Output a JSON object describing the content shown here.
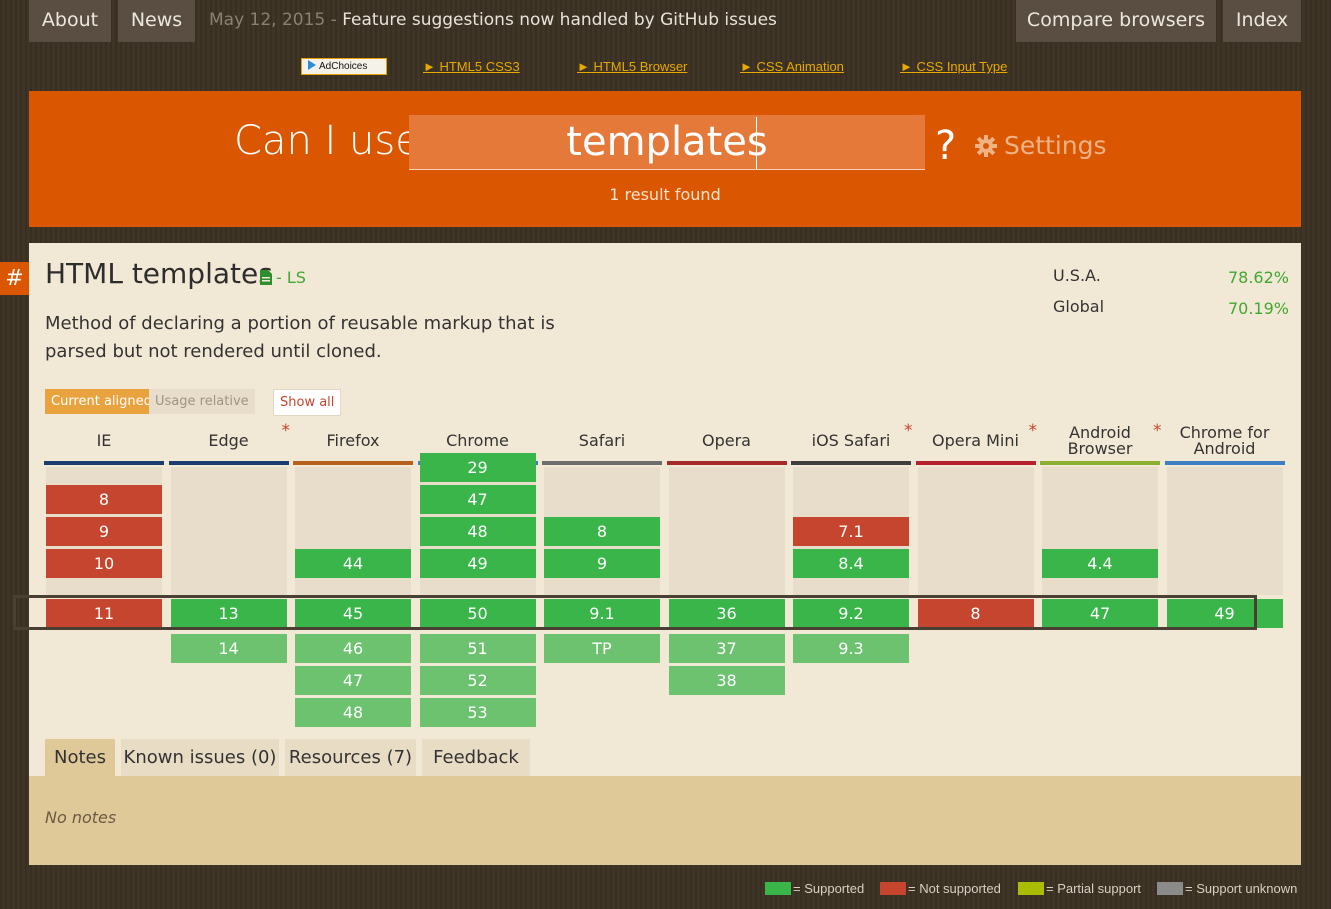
{
  "nav": {
    "about": "About",
    "news": "News",
    "news_date": "May 12, 2015 - ",
    "news_text": "Feature suggestions now handled by GitHub issues",
    "compare": "Compare browsers",
    "index": "Index"
  },
  "ads": {
    "adchoices": "AdChoices",
    "links": [
      "► HTML5 CSS3",
      "► HTML5 Browser",
      "► CSS Animation",
      "► CSS Input Type"
    ]
  },
  "search": {
    "prefix": "Can I use",
    "query": "templates",
    "question_mark": "?",
    "settings": "Settings",
    "result_count": "1 result found"
  },
  "feature": {
    "anchor": "#",
    "title": "HTML templates",
    "spec_status": "- LS",
    "description": "Method of declaring a portion of reusable markup that is parsed but not rendered until cloned.",
    "usage": [
      {
        "label": "U.S.A.",
        "value": "78.62%"
      },
      {
        "label": "Global",
        "value": "70.19%"
      }
    ],
    "toggles": {
      "current_aligned": "Current aligned",
      "usage_relative": "Usage relative",
      "show_all": "Show all"
    }
  },
  "colors": {
    "supported": "#39b54a",
    "supported_future": "#6cc26f",
    "not_supported": "#c6452f",
    "partial": "#a8bd04",
    "unknown": "#8b8b8b",
    "brand_orange": "#db5600"
  },
  "browsers": [
    {
      "name": "IE",
      "bar": "#1a3c6e",
      "star": false,
      "past": [
        {
          "v": "8",
          "s": "n"
        },
        {
          "v": "9",
          "s": "n"
        },
        {
          "v": "10",
          "s": "n"
        }
      ],
      "current": {
        "v": "11",
        "s": "n"
      },
      "future": []
    },
    {
      "name": "Edge",
      "bar": "#1a3c6e",
      "star": true,
      "past": [],
      "current": {
        "v": "13",
        "s": "y"
      },
      "future": [
        {
          "v": "14",
          "s": "y"
        }
      ]
    },
    {
      "name": "Firefox",
      "bar": "#b5601c",
      "star": false,
      "past": [
        {
          "v": "44",
          "s": "y"
        }
      ],
      "current": {
        "v": "45",
        "s": "y"
      },
      "future": [
        {
          "v": "46",
          "s": "y"
        },
        {
          "v": "47",
          "s": "y"
        },
        {
          "v": "48",
          "s": "y"
        }
      ]
    },
    {
      "name": "Chrome",
      "bar": "#3d7fc1",
      "star": false,
      "past": [
        {
          "v": "29",
          "s": "y"
        },
        {
          "v": "47",
          "s": "y"
        },
        {
          "v": "48",
          "s": "y"
        },
        {
          "v": "49",
          "s": "y"
        }
      ],
      "current": {
        "v": "50",
        "s": "y"
      },
      "future": [
        {
          "v": "51",
          "s": "y"
        },
        {
          "v": "52",
          "s": "y"
        },
        {
          "v": "53",
          "s": "y"
        }
      ]
    },
    {
      "name": "Safari",
      "bar": "#6d6d6d",
      "star": false,
      "past": [
        {
          "v": "8",
          "s": "y"
        },
        {
          "v": "9",
          "s": "y"
        }
      ],
      "current": {
        "v": "9.1",
        "s": "y"
      },
      "future": [
        {
          "v": "TP",
          "s": "y"
        }
      ]
    },
    {
      "name": "Opera",
      "bar": "#a52a2a",
      "star": false,
      "past": [],
      "current": {
        "v": "36",
        "s": "y"
      },
      "future": [
        {
          "v": "37",
          "s": "y"
        },
        {
          "v": "38",
          "s": "y"
        }
      ]
    },
    {
      "name": "iOS Safari",
      "bar": "#3f3f3f",
      "star": true,
      "past": [
        {
          "v": "7.1",
          "s": "n"
        },
        {
          "v": "8.4",
          "s": "y"
        }
      ],
      "current": {
        "v": "9.2",
        "s": "y"
      },
      "future": [
        {
          "v": "9.3",
          "s": "y"
        }
      ]
    },
    {
      "name": "Opera Mini",
      "bar": "#b5202c",
      "star": true,
      "past": [],
      "current": {
        "v": "8",
        "s": "n"
      },
      "future": []
    },
    {
      "name": "Android Browser",
      "bar": "#8bb02f",
      "star": true,
      "past": [
        {
          "v": "4.4",
          "s": "y"
        }
      ],
      "current": {
        "v": "47",
        "s": "y"
      },
      "future": []
    },
    {
      "name": "Chrome for Android",
      "bar": "#3d7fc1",
      "star": false,
      "past": [],
      "current": {
        "v": "49",
        "s": "y"
      },
      "future": []
    }
  ],
  "tabs": [
    "Notes",
    "Known issues (0)",
    "Resources (7)",
    "Feedback"
  ],
  "notes_text": "No notes",
  "legend": [
    {
      "label": "= Supported",
      "color": "#39b54a"
    },
    {
      "label": "= Not supported",
      "color": "#c6452f"
    },
    {
      "label": "= Partial support",
      "color": "#a8bd04"
    },
    {
      "label": "= Support unknown",
      "color": "#8b8b8b"
    }
  ]
}
